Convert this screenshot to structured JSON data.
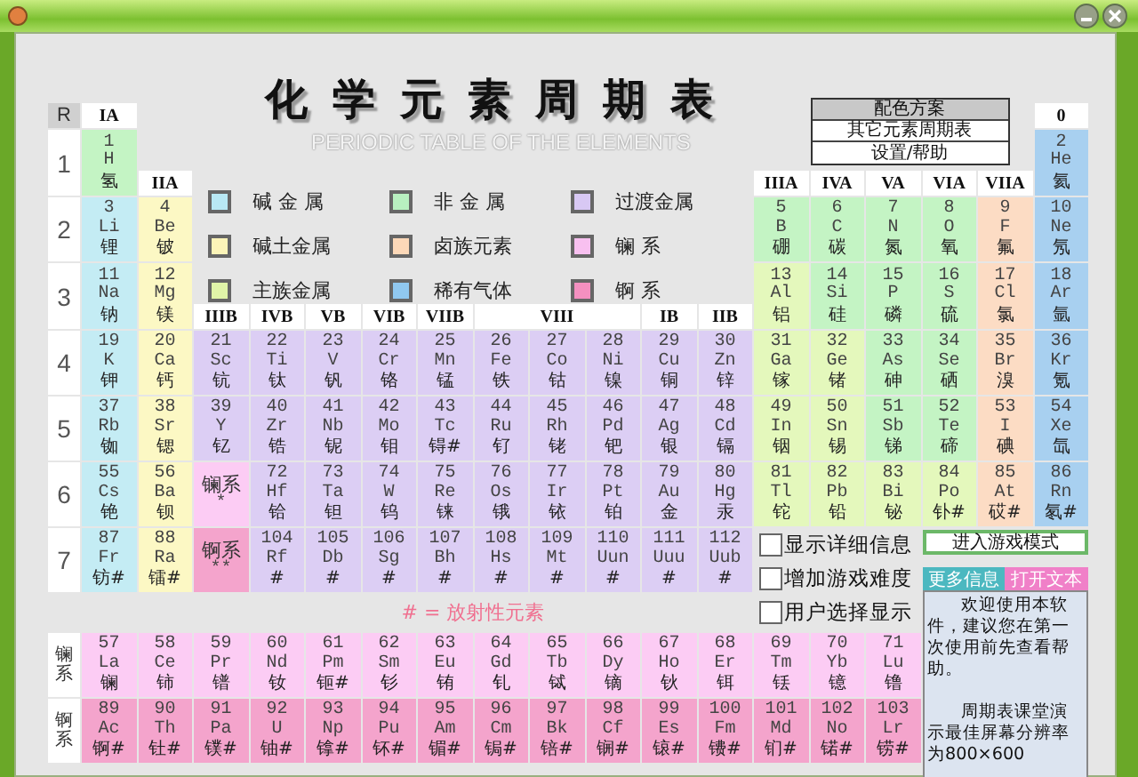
{
  "title": {
    "main": "化学元素周期表",
    "sub": "PERIODIC TABLE OF THE ELEMENTS"
  },
  "menu": [
    {
      "label": "配色方案",
      "selected": true
    },
    {
      "label": "其它元素周期表",
      "selected": false
    },
    {
      "label": "设置/帮助",
      "selected": false
    }
  ],
  "legend": [
    {
      "label": "碱 金 属",
      "color": "#b8e8f4"
    },
    {
      "label": "非 金 属",
      "color": "#b8f0c0"
    },
    {
      "label": "过渡金属",
      "color": "#d8c8f4"
    },
    {
      "label": "碱土金属",
      "color": "#fcf4b8"
    },
    {
      "label": "卤族元素",
      "color": "#fcd8b8"
    },
    {
      "label": "镧 系",
      "color": "#f8c0f0"
    },
    {
      "label": "主族金属",
      "color": "#e0f4a8"
    },
    {
      "label": "稀有气体",
      "color": "#90c8f0"
    },
    {
      "label": "锕 系",
      "color": "#f490c0"
    }
  ],
  "corner": "R",
  "groups": [
    {
      "label": "IA"
    },
    {
      "label": "IIA"
    },
    {
      "label": "IIIB"
    },
    {
      "label": "IVB"
    },
    {
      "label": "VB"
    },
    {
      "label": "VIB"
    },
    {
      "label": "VIIB"
    },
    {
      "label": "VIII"
    },
    {
      "label": "IB"
    },
    {
      "label": "IIB"
    },
    {
      "label": "IIIA"
    },
    {
      "label": "IVA"
    },
    {
      "label": "VA"
    },
    {
      "label": "VIA"
    },
    {
      "label": "VIIA"
    },
    {
      "label": "0"
    }
  ],
  "periods": [
    {
      "label": "1",
      "cells": [
        {
          "kind": "element",
          "number": "1",
          "symbol": "H",
          "name": "氢",
          "color": "#c4f4c4"
        },
        {
          "kind": "element",
          "number": "2",
          "symbol": "He",
          "name": "氦",
          "color": "#a8d0f0"
        }
      ]
    },
    {
      "label": "2",
      "cells": [
        {
          "kind": "element",
          "number": "3",
          "symbol": "Li",
          "name": "锂",
          "color": "#c4ecf4"
        },
        {
          "kind": "element",
          "number": "4",
          "symbol": "Be",
          "name": "铍",
          "color": "#fcf8c4"
        },
        {
          "kind": "element",
          "number": "5",
          "symbol": "B",
          "name": "硼",
          "color": "#c4f4c4"
        },
        {
          "kind": "element",
          "number": "6",
          "symbol": "C",
          "name": "碳",
          "color": "#c4f4c4"
        },
        {
          "kind": "element",
          "number": "7",
          "symbol": "N",
          "name": "氮",
          "color": "#c4f4c4"
        },
        {
          "kind": "element",
          "number": "8",
          "symbol": "O",
          "name": "氧",
          "color": "#c4f4c4"
        },
        {
          "kind": "element",
          "number": "9",
          "symbol": "F",
          "name": "氟",
          "color": "#fcdcc4"
        },
        {
          "kind": "element",
          "number": "10",
          "symbol": "Ne",
          "name": "氖",
          "color": "#a8d0f0"
        }
      ]
    },
    {
      "label": "3",
      "cells": [
        {
          "kind": "element",
          "number": "11",
          "symbol": "Na",
          "name": "钠",
          "color": "#c4ecf4"
        },
        {
          "kind": "element",
          "number": "12",
          "symbol": "Mg",
          "name": "镁",
          "color": "#fcf8c4"
        },
        {
          "kind": "element",
          "number": "13",
          "symbol": "Al",
          "name": "铝",
          "color": "#e4f8bc"
        },
        {
          "kind": "element",
          "number": "14",
          "symbol": "Si",
          "name": "硅",
          "color": "#c4f4c4"
        },
        {
          "kind": "element",
          "number": "15",
          "symbol": "P",
          "name": "磷",
          "color": "#c4f4c4"
        },
        {
          "kind": "element",
          "number": "16",
          "symbol": "S",
          "name": "硫",
          "color": "#c4f4c4"
        },
        {
          "kind": "element",
          "number": "17",
          "symbol": "Cl",
          "name": "氯",
          "color": "#fcdcc4"
        },
        {
          "kind": "element",
          "number": "18",
          "symbol": "Ar",
          "name": "氩",
          "color": "#a8d0f0"
        }
      ]
    },
    {
      "label": "4",
      "cells": [
        {
          "kind": "element",
          "number": "19",
          "symbol": "K",
          "name": "钾",
          "color": "#c4ecf4"
        },
        {
          "kind": "element",
          "number": "20",
          "symbol": "Ca",
          "name": "钙",
          "color": "#fcf8c4"
        },
        {
          "kind": "element",
          "number": "21",
          "symbol": "Sc",
          "name": "钪",
          "color": "#dccef4"
        },
        {
          "kind": "element",
          "number": "22",
          "symbol": "Ti",
          "name": "钛",
          "color": "#dccef4"
        },
        {
          "kind": "element",
          "number": "23",
          "symbol": "V",
          "name": "钒",
          "color": "#dccef4"
        },
        {
          "kind": "element",
          "number": "24",
          "symbol": "Cr",
          "name": "铬",
          "color": "#dccef4"
        },
        {
          "kind": "element",
          "number": "25",
          "symbol": "Mn",
          "name": "锰",
          "color": "#dccef4"
        },
        {
          "kind": "element",
          "number": "26",
          "symbol": "Fe",
          "name": "铁",
          "color": "#dccef4"
        },
        {
          "kind": "element",
          "number": "27",
          "symbol": "Co",
          "name": "钴",
          "color": "#dccef4"
        },
        {
          "kind": "element",
          "number": "28",
          "symbol": "Ni",
          "name": "镍",
          "color": "#dccef4"
        },
        {
          "kind": "element",
          "number": "29",
          "symbol": "Cu",
          "name": "铜",
          "color": "#dccef4"
        },
        {
          "kind": "element",
          "number": "30",
          "symbol": "Zn",
          "name": "锌",
          "color": "#dccef4"
        },
        {
          "kind": "element",
          "number": "31",
          "symbol": "Ga",
          "name": "镓",
          "color": "#e4f8bc"
        },
        {
          "kind": "element",
          "number": "32",
          "symbol": "Ge",
          "name": "锗",
          "color": "#e4f8bc"
        },
        {
          "kind": "element",
          "number": "33",
          "symbol": "As",
          "name": "砷",
          "color": "#c4f4c4"
        },
        {
          "kind": "element",
          "number": "34",
          "symbol": "Se",
          "name": "硒",
          "color": "#c4f4c4"
        },
        {
          "kind": "element",
          "number": "35",
          "symbol": "Br",
          "name": "溴",
          "color": "#fcdcc4"
        },
        {
          "kind": "element",
          "number": "36",
          "symbol": "Kr",
          "name": "氪",
          "color": "#a8d0f0"
        }
      ]
    },
    {
      "label": "5",
      "cells": [
        {
          "kind": "element",
          "number": "37",
          "symbol": "Rb",
          "name": "铷",
          "color": "#c4ecf4"
        },
        {
          "kind": "element",
          "number": "38",
          "symbol": "Sr",
          "name": "锶",
          "color": "#fcf8c4"
        },
        {
          "kind": "element",
          "number": "39",
          "symbol": "Y",
          "name": "钇",
          "color": "#dccef4"
        },
        {
          "kind": "element",
          "number": "40",
          "symbol": "Zr",
          "name": "锆",
          "color": "#dccef4"
        },
        {
          "kind": "element",
          "number": "41",
          "symbol": "Nb",
          "name": "铌",
          "color": "#dccef4"
        },
        {
          "kind": "element",
          "number": "42",
          "symbol": "Mo",
          "name": "钼",
          "color": "#dccef4"
        },
        {
          "kind": "element",
          "number": "43",
          "symbol": "Tc",
          "name": "锝#",
          "color": "#dccef4"
        },
        {
          "kind": "element",
          "number": "44",
          "symbol": "Ru",
          "name": "钌",
          "color": "#dccef4"
        },
        {
          "kind": "element",
          "number": "45",
          "symbol": "Rh",
          "name": "铑",
          "color": "#dccef4"
        },
        {
          "kind": "element",
          "number": "46",
          "symbol": "Pd",
          "name": "钯",
          "color": "#dccef4"
        },
        {
          "kind": "element",
          "number": "47",
          "symbol": "Ag",
          "name": "银",
          "color": "#dccef4"
        },
        {
          "kind": "element",
          "number": "48",
          "symbol": "Cd",
          "name": "镉",
          "color": "#dccef4"
        },
        {
          "kind": "element",
          "number": "49",
          "symbol": "In",
          "name": "铟",
          "color": "#e4f8bc"
        },
        {
          "kind": "element",
          "number": "50",
          "symbol": "Sn",
          "name": "锡",
          "color": "#e4f8bc"
        },
        {
          "kind": "element",
          "number": "51",
          "symbol": "Sb",
          "name": "锑",
          "color": "#c4f4c4"
        },
        {
          "kind": "element",
          "number": "52",
          "symbol": "Te",
          "name": "碲",
          "color": "#c4f4c4"
        },
        {
          "kind": "element",
          "number": "53",
          "symbol": "I",
          "name": "碘",
          "color": "#fcdcc4"
        },
        {
          "kind": "element",
          "number": "54",
          "symbol": "Xe",
          "name": "氙",
          "color": "#a8d0f0"
        }
      ]
    },
    {
      "label": "6",
      "cells": [
        {
          "kind": "element",
          "number": "55",
          "symbol": "Cs",
          "name": "铯",
          "color": "#c4ecf4"
        },
        {
          "kind": "element",
          "number": "56",
          "symbol": "Ba",
          "name": "钡",
          "color": "#fcf8c4"
        },
        {
          "kind": "series",
          "name": "镧系",
          "mark": "*",
          "color": "#fcccf4"
        },
        {
          "kind": "element",
          "number": "72",
          "symbol": "Hf",
          "name": "铪",
          "color": "#dccef4"
        },
        {
          "kind": "element",
          "number": "73",
          "symbol": "Ta",
          "name": "钽",
          "color": "#dccef4"
        },
        {
          "kind": "element",
          "number": "74",
          "symbol": "W",
          "name": "钨",
          "color": "#dccef4"
        },
        {
          "kind": "element",
          "number": "75",
          "symbol": "Re",
          "name": "铼",
          "color": "#dccef4"
        },
        {
          "kind": "element",
          "number": "76",
          "symbol": "Os",
          "name": "锇",
          "color": "#dccef4"
        },
        {
          "kind": "element",
          "number": "77",
          "symbol": "Ir",
          "name": "铱",
          "color": "#dccef4"
        },
        {
          "kind": "element",
          "number": "78",
          "symbol": "Pt",
          "name": "铂",
          "color": "#dccef4"
        },
        {
          "kind": "element",
          "number": "79",
          "symbol": "Au",
          "name": "金",
          "color": "#dccef4"
        },
        {
          "kind": "element",
          "number": "80",
          "symbol": "Hg",
          "name": "汞",
          "color": "#dccef4"
        },
        {
          "kind": "element",
          "number": "81",
          "symbol": "Tl",
          "name": "铊",
          "color": "#e4f8bc"
        },
        {
          "kind": "element",
          "number": "82",
          "symbol": "Pb",
          "name": "铅",
          "color": "#e4f8bc"
        },
        {
          "kind": "element",
          "number": "83",
          "symbol": "Bi",
          "name": "铋",
          "color": "#e4f8bc"
        },
        {
          "kind": "element",
          "number": "84",
          "symbol": "Po",
          "name": "钋#",
          "color": "#e4f8bc"
        },
        {
          "kind": "element",
          "number": "85",
          "symbol": "At",
          "name": "砹#",
          "color": "#fcdcc4"
        },
        {
          "kind": "element",
          "number": "86",
          "symbol": "Rn",
          "name": "氡#",
          "color": "#a8d0f0"
        }
      ]
    },
    {
      "label": "7",
      "cells": [
        {
          "kind": "element",
          "number": "87",
          "symbol": "Fr",
          "name": "钫#",
          "color": "#c4ecf4"
        },
        {
          "kind": "element",
          "number": "88",
          "symbol": "Ra",
          "name": "镭#",
          "color": "#fcf8c4"
        },
        {
          "kind": "series",
          "name": "锕系",
          "mark": "**",
          "color": "#f4a4cc"
        },
        {
          "kind": "element",
          "number": "104",
          "symbol": "Rf",
          "name": "#",
          "color": "#dccef4"
        },
        {
          "kind": "element",
          "number": "105",
          "symbol": "Db",
          "name": "#",
          "color": "#dccef4"
        },
        {
          "kind": "element",
          "number": "106",
          "symbol": "Sg",
          "name": "#",
          "color": "#dccef4"
        },
        {
          "kind": "element",
          "number": "107",
          "symbol": "Bh",
          "name": "#",
          "color": "#dccef4"
        },
        {
          "kind": "element",
          "number": "108",
          "symbol": "Hs",
          "name": "#",
          "color": "#dccef4"
        },
        {
          "kind": "element",
          "number": "109",
          "symbol": "Mt",
          "name": "#",
          "color": "#dccef4"
        },
        {
          "kind": "element",
          "number": "110",
          "symbol": "Uun",
          "name": "#",
          "color": "#dccef4"
        },
        {
          "kind": "element",
          "number": "111",
          "symbol": "Uuu",
          "name": "#",
          "color": "#dccef4"
        },
        {
          "kind": "element",
          "number": "112",
          "symbol": "Uub",
          "name": "#",
          "color": "#dccef4"
        }
      ]
    }
  ],
  "note": "# = 放射性元素",
  "series": [
    {
      "label": "镧系",
      "elements": [
        {
          "number": "57",
          "symbol": "La",
          "name": "镧",
          "color": "#fcccf4"
        },
        {
          "number": "58",
          "symbol": "Ce",
          "name": "铈",
          "color": "#fcccf4"
        },
        {
          "number": "59",
          "symbol": "Pr",
          "name": "镨",
          "color": "#fcccf4"
        },
        {
          "number": "60",
          "symbol": "Nd",
          "name": "钕",
          "color": "#fcccf4"
        },
        {
          "number": "61",
          "symbol": "Pm",
          "name": "钷#",
          "color": "#fcccf4"
        },
        {
          "number": "62",
          "symbol": "Sm",
          "name": "钐",
          "color": "#fcccf4"
        },
        {
          "number": "63",
          "symbol": "Eu",
          "name": "铕",
          "color": "#fcccf4"
        },
        {
          "number": "64",
          "symbol": "Gd",
          "name": "钆",
          "color": "#fcccf4"
        },
        {
          "number": "65",
          "symbol": "Tb",
          "name": "铽",
          "color": "#fcccf4"
        },
        {
          "number": "66",
          "symbol": "Dy",
          "name": "镝",
          "color": "#fcccf4"
        },
        {
          "number": "67",
          "symbol": "Ho",
          "name": "钬",
          "color": "#fcccf4"
        },
        {
          "number": "68",
          "symbol": "Er",
          "name": "铒",
          "color": "#fcccf4"
        },
        {
          "number": "69",
          "symbol": "Tm",
          "name": "铥",
          "color": "#fcccf4"
        },
        {
          "number": "70",
          "symbol": "Yb",
          "name": "镱",
          "color": "#fcccf4"
        },
        {
          "number": "71",
          "symbol": "Lu",
          "name": "镥",
          "color": "#fcccf4"
        }
      ]
    },
    {
      "label": "锕系",
      "elements": [
        {
          "number": "89",
          "symbol": "Ac",
          "name": "锕#",
          "color": "#f4a4cc"
        },
        {
          "number": "90",
          "symbol": "Th",
          "name": "钍#",
          "color": "#f4a4cc"
        },
        {
          "number": "91",
          "symbol": "Pa",
          "name": "镤#",
          "color": "#f4a4cc"
        },
        {
          "number": "92",
          "symbol": "U",
          "name": "铀#",
          "color": "#f4a4cc"
        },
        {
          "number": "93",
          "symbol": "Np",
          "name": "镎#",
          "color": "#f4a4cc"
        },
        {
          "number": "94",
          "symbol": "Pu",
          "name": "钚#",
          "color": "#f4a4cc"
        },
        {
          "number": "95",
          "symbol": "Am",
          "name": "镅#",
          "color": "#f4a4cc"
        },
        {
          "number": "96",
          "symbol": "Cm",
          "name": "锔#",
          "color": "#f4a4cc"
        },
        {
          "number": "97",
          "symbol": "Bk",
          "name": "锫#",
          "color": "#f4a4cc"
        },
        {
          "number": "98",
          "symbol": "Cf",
          "name": "锎#",
          "color": "#f4a4cc"
        },
        {
          "number": "99",
          "symbol": "Es",
          "name": "锿#",
          "color": "#f4a4cc"
        },
        {
          "number": "100",
          "symbol": "Fm",
          "name": "镄#",
          "color": "#f4a4cc"
        },
        {
          "number": "101",
          "symbol": "Md",
          "name": "钔#",
          "color": "#f4a4cc"
        },
        {
          "number": "102",
          "symbol": "No",
          "name": "锘#",
          "color": "#f4a4cc"
        },
        {
          "number": "103",
          "symbol": "Lr",
          "name": "铹#",
          "color": "#f4a4cc"
        }
      ]
    }
  ],
  "options": [
    {
      "label": "显示详细信息",
      "checked": false
    },
    {
      "label": "增加游戏难度",
      "checked": false
    },
    {
      "label": "用户选择显示",
      "checked": false
    }
  ],
  "buttons": [
    {
      "kind": "wide",
      "label": "进入游戏模式",
      "color": "#6cb868"
    },
    {
      "kind": "half",
      "label": "更多信息",
      "color": "#4cb8c0"
    },
    {
      "kind": "half",
      "label": "打开文本",
      "color": "#f080c8"
    }
  ],
  "info": [
    "欢迎使用本软件，建议您在第一次使用前先查看帮助。",
    "周期表课堂演示最佳屏幕分辨率为800×600"
  ]
}
